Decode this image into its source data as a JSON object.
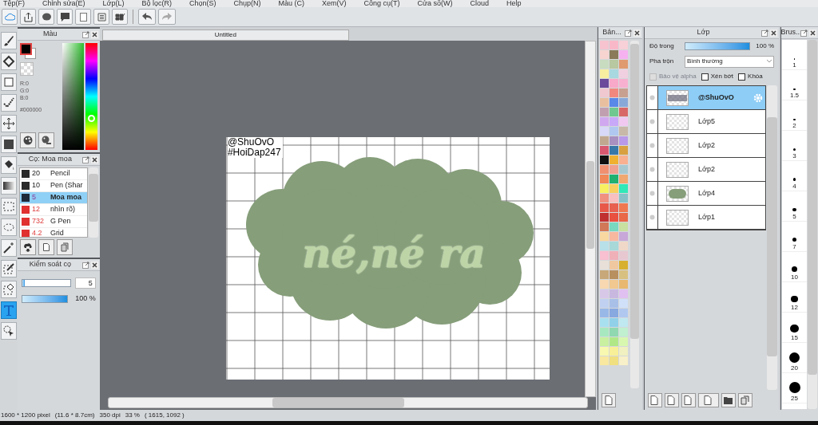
{
  "menu": [
    "Tệp(F)",
    "Chỉnh sửa(E)",
    "Lớp(L)",
    "Bộ lọc(R)",
    "Chọn(S)",
    "Chụp(N)",
    "Màu (C)",
    "Xem(V)",
    "Công cụ(T)",
    "Cửa sổ(W)",
    "Cloud",
    "Help"
  ],
  "tools": [
    {
      "kind": "brush",
      "selected": false
    },
    {
      "kind": "eraser",
      "selected": false
    },
    {
      "kind": "rect",
      "selected": false
    },
    {
      "kind": "dotpen",
      "selected": false
    },
    {
      "kind": "move",
      "selected": false
    },
    {
      "kind": "fill",
      "selected": false
    },
    {
      "kind": "bucket",
      "selected": false
    },
    {
      "kind": "gradient",
      "selected": false
    },
    {
      "kind": "select",
      "selected": false
    },
    {
      "kind": "lasso",
      "selected": false
    },
    {
      "kind": "wand",
      "selected": false
    },
    {
      "kind": "selpen",
      "selected": false
    },
    {
      "kind": "selerase",
      "selected": false
    },
    {
      "kind": "text",
      "selected": true
    },
    {
      "kind": "pointer",
      "selected": false
    }
  ],
  "color_panel": {
    "title": "Màu",
    "r": "R:0",
    "g": "G:0",
    "b": "B:0",
    "hex": "#000000"
  },
  "brush_panel": {
    "title": "Cọ: Moa moa",
    "items": [
      {
        "color": "#2a2a2a",
        "size": "20",
        "name": "Pencil",
        "selected": false
      },
      {
        "color": "#2a2a2a",
        "size": "10",
        "name": "Pen (Shar",
        "selected": false
      },
      {
        "color": "#1e2a3a",
        "size": "5",
        "name": "Moa moa",
        "selected": true
      },
      {
        "color": "#e03030",
        "size": "12",
        "name": "nhìn rõ)",
        "selected": false
      },
      {
        "color": "#e03030",
        "size": "732",
        "name": "G Pen",
        "selected": false
      },
      {
        "color": "#e03030",
        "size": "4.2",
        "name": "Grid",
        "selected": false
      }
    ]
  },
  "brush_control": {
    "title": "Kiểm soát cọ",
    "size": {
      "level": 0.05,
      "value": "5"
    },
    "opacity": {
      "level": 1,
      "reading": "100 %"
    }
  },
  "document_tab": "Untitled",
  "canvas": {
    "signature": [
      "@ShuOvO",
      "#HoiDap247"
    ],
    "art_text": "né,né ra"
  },
  "palette": {
    "title": "Bản...",
    "swatches": [
      {
        "color": "#f6c3cf"
      },
      {
        "color": "#f9b8c8"
      },
      {
        "color": "#f8d0d8"
      },
      {
        "color": "#f7d4d0"
      },
      {
        "color": "#8a7a5a"
      },
      {
        "color": "#f6b2f0"
      },
      {
        "color": "#c8dcc0"
      },
      {
        "color": "#b8c8a0"
      },
      {
        "color": "#e09a70"
      },
      {
        "color": "#f8f0a0"
      },
      {
        "color": "#a8d8e0"
      },
      {
        "color": "#f0d0e0"
      },
      {
        "color": "#6a4a9a"
      },
      {
        "color": "#f8a8c8"
      },
      {
        "color": "#f8b0d0"
      },
      {
        "color": "#f0c8d0"
      },
      {
        "color": "#f08880"
      },
      {
        "color": "#c8a090"
      },
      {
        "color": "#e8c0a0"
      },
      {
        "color": "#5888e8"
      },
      {
        "color": "#88a8d8"
      },
      {
        "color": "#c0a0b0"
      },
      {
        "color": "#70c890"
      },
      {
        "color": "#d86868"
      },
      {
        "color": "#d0a8f0"
      },
      {
        "color": "#c8a8f8"
      },
      {
        "color": "#f0c8f0"
      },
      {
        "color": "#d8d8f8"
      },
      {
        "color": "#b0c8f0"
      },
      {
        "color": "#c8b8a8"
      },
      {
        "color": "#c0a890"
      },
      {
        "color": "#a890c0"
      },
      {
        "color": "#b898e8"
      },
      {
        "color": "#d85870"
      },
      {
        "color": "#3878a8"
      },
      {
        "color": "#d8a040"
      },
      {
        "color": "#101010"
      },
      {
        "color": "#f0b030"
      },
      {
        "color": "#f8b090"
      },
      {
        "color": "#f09070"
      },
      {
        "color": "#f0a090"
      },
      {
        "color": "#a8c8d0"
      },
      {
        "color": "#f08858"
      },
      {
        "color": "#20b070"
      },
      {
        "color": "#f0a870"
      },
      {
        "color": "#f8f060"
      },
      {
        "color": "#f8d060"
      },
      {
        "color": "#30e8b8"
      },
      {
        "color": "#f09080"
      },
      {
        "color": "#f8c0c0"
      },
      {
        "color": "#88c0c8"
      },
      {
        "color": "#e85848"
      },
      {
        "color": "#e86050"
      },
      {
        "color": "#f07850"
      },
      {
        "color": "#c03030"
      },
      {
        "color": "#e85040"
      },
      {
        "color": "#e86848"
      },
      {
        "color": "#d07858"
      },
      {
        "color": "#78d8c0"
      },
      {
        "color": "#c8e0a0"
      },
      {
        "color": "#f8d8a0"
      },
      {
        "color": "#f8b8a0"
      },
      {
        "color": "#c8a8d8"
      },
      {
        "color": "#b8e0e8"
      },
      {
        "color": "#a8d8d8"
      },
      {
        "color": "#f0d8c8"
      },
      {
        "color": "#f8c0d0"
      },
      {
        "color": "#f0b0b8"
      },
      {
        "color": "#e8c8d0"
      },
      {
        "color": "#e8e0d8"
      },
      {
        "color": "#f0c8a0"
      },
      {
        "color": "#d8b030"
      },
      {
        "color": "#c8a878"
      },
      {
        "color": "#b89060"
      },
      {
        "color": "#d8c080"
      },
      {
        "color": "#f8d8b0"
      },
      {
        "color": "#f0c890"
      },
      {
        "color": "#e8b870"
      },
      {
        "color": "#d8c8e8"
      },
      {
        "color": "#c8b8e0"
      },
      {
        "color": "#e0c0f0"
      },
      {
        "color": "#c0d0f0"
      },
      {
        "color": "#a8c0e8"
      },
      {
        "color": "#d0e0f8"
      },
      {
        "color": "#98b8e8"
      },
      {
        "color": "#88a8e0"
      },
      {
        "color": "#b0c8f0"
      },
      {
        "color": "#a8e0f0"
      },
      {
        "color": "#90d0e8"
      },
      {
        "color": "#c0e8f0"
      },
      {
        "color": "#a8e8c0"
      },
      {
        "color": "#90d8b0"
      },
      {
        "color": "#c0f0d0"
      },
      {
        "color": "#c8f0a0"
      },
      {
        "color": "#b0e888"
      },
      {
        "color": "#d8f8b0"
      },
      {
        "color": "#f8f8b0"
      },
      {
        "color": "#f8f098"
      },
      {
        "color": "#f0f0c0"
      },
      {
        "color": "#f8e8a0"
      },
      {
        "color": "#f0e080"
      },
      {
        "color": "#f8f0c8"
      }
    ]
  },
  "layer_panel": {
    "title": "Lớp",
    "opacity_label": "Độ trong",
    "opacity": {
      "level": 1,
      "reading": "100 %"
    },
    "blend_label": "Pha trộn",
    "blend_value": "Bình thường",
    "options": [
      {
        "label": "Bảo vệ alpha",
        "checked": false,
        "disabled": true
      },
      {
        "label": "Xén bớt",
        "checked": false,
        "disabled": false
      },
      {
        "label": "Khóa",
        "checked": false,
        "disabled": false
      }
    ],
    "layers": [
      {
        "name": "@ShuOvO",
        "kind": "text",
        "selected": true
      },
      {
        "name": "Lớp5",
        "kind": "empty",
        "selected": false
      },
      {
        "name": "Lớp2",
        "kind": "empty",
        "selected": false
      },
      {
        "name": "Lớp2",
        "kind": "empty",
        "selected": false
      },
      {
        "name": "Lớp4",
        "kind": "cloud",
        "selected": false
      },
      {
        "name": "Lớp1",
        "kind": "empty",
        "selected": false
      }
    ]
  },
  "brush_sizes": {
    "title": "Brus...",
    "sizes": [
      "1",
      "1.5",
      "2",
      "3",
      "4",
      "5",
      "7",
      "10",
      "12",
      "15",
      "20",
      "25"
    ]
  },
  "status_bar": [
    "1600 * 1200 pixel",
    "(11.6 * 8.7cm)",
    "350 dpi",
    "33 %",
    "( 1615, 1092 )"
  ]
}
